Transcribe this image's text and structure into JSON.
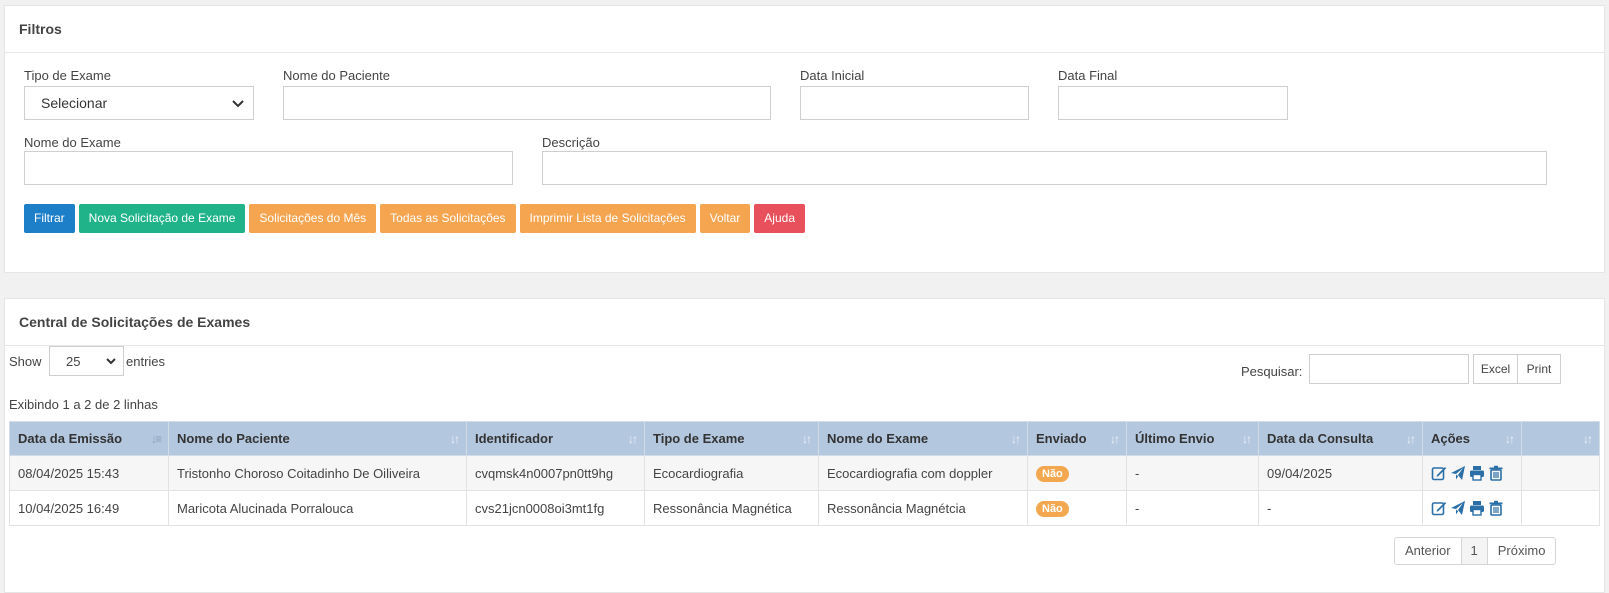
{
  "filters": {
    "title": "Filtros",
    "tipo_label": "Tipo de Exame",
    "tipo_value": "Selecionar",
    "paciente_label": "Nome do Paciente",
    "data_inicial_label": "Data Inicial",
    "data_final_label": "Data Final",
    "nome_exame_label": "Nome do Exame",
    "descricao_label": "Descrição",
    "buttons": {
      "filtrar": "Filtrar",
      "nova": "Nova Solicitação de Exame",
      "mes": "Solicitações do Mês",
      "todas": "Todas as Solicitações",
      "imprimir": "Imprimir Lista de Solicitações",
      "voltar": "Voltar",
      "ajuda": "Ajuda"
    }
  },
  "list": {
    "title": "Central de Solicitações de Exames",
    "show_label": "Show",
    "show_value": "25",
    "entries_label": "entries",
    "search_label": "Pesquisar:",
    "excel": "Excel",
    "print": "Print",
    "info": "Exibindo 1 a 2 de 2 linhas",
    "columns": [
      "Data da Emissão",
      "Nome do Paciente",
      "Identificador",
      "Tipo de Exame",
      "Nome do Exame",
      "Enviado",
      "Último Envio",
      "Data da Consulta",
      "Ações",
      ""
    ],
    "rows": [
      {
        "data_emissao": "08/04/2025 15:43",
        "paciente": "Tristonho Choroso Coitadinho De Oiliveira",
        "identificador": "cvqmsk4n0007pn0tt9hg",
        "tipo": "Ecocardiografia",
        "nome_exame": "Ecocardiografia com doppler",
        "enviado": "Não",
        "ultimo_envio": "-",
        "data_consulta": "09/04/2025"
      },
      {
        "data_emissao": "10/04/2025 16:49",
        "paciente": "Maricota Alucinada Porralouca",
        "identificador": "cvs21jcn0008oi3mt1fg",
        "tipo": "Ressonância Magnética",
        "nome_exame": "Ressonância Magnétcia",
        "enviado": "Não",
        "ultimo_envio": "-",
        "data_consulta": "-"
      }
    ],
    "action_icons": [
      "edit-icon",
      "send-icon",
      "print-icon",
      "trash-icon"
    ],
    "pager": {
      "prev": "Anterior",
      "page": "1",
      "next": "Próximo"
    }
  },
  "colors": {
    "blue": "#1e7fc9",
    "green": "#20b38a",
    "orange": "#f5a450",
    "red": "#e8505b",
    "header_bg": "#b3c7df",
    "link": "#2a6fa8",
    "icon": "#2a6fa8"
  }
}
